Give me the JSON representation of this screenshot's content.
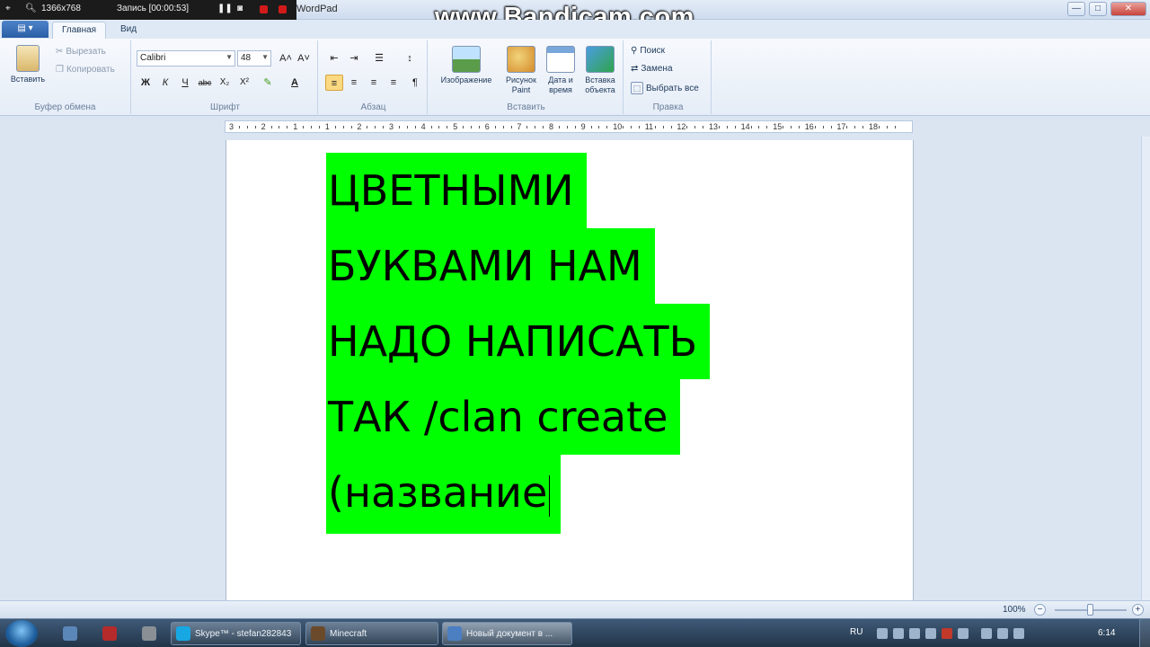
{
  "recorder": {
    "resolution": "1366x768",
    "record_label": "Запись [00:00:53]",
    "watermark": "www.Bandicam.com"
  },
  "window": {
    "title": "WordPad",
    "controls": {
      "minimize": "—",
      "maximize": "□",
      "close": "✕"
    }
  },
  "tabs": {
    "app_menu": "▤ ▾",
    "home": "Главная",
    "view": "Вид"
  },
  "ribbon": {
    "clipboard": {
      "label": "Буфер обмена",
      "paste": "Вставить",
      "cut": "Вырезать",
      "copy": "Копировать"
    },
    "font": {
      "label": "Шрифт",
      "family": "Calibri",
      "size": "48",
      "bold": "Ж",
      "italic": "К",
      "underline": "Ч",
      "strike": "abc",
      "subscript": "X₂",
      "superscript": "X²",
      "grow": "A˄",
      "shrink": "A˅",
      "highlight": "✎",
      "color": "A"
    },
    "paragraph": {
      "label": "Абзац",
      "decrease_indent": "⇤",
      "increase_indent": "⇥",
      "list": "☰",
      "spacing": "↕",
      "align_left": "≡",
      "align_center": "≡",
      "align_right": "≡",
      "justify": "≡",
      "paragraph_dialog": "¶"
    },
    "insert": {
      "label": "Вставить",
      "picture": "Изображение",
      "paint_line1": "Рисунок",
      "paint_line2": "Paint",
      "datetime_line1": "Дата и",
      "datetime_line2": "время",
      "object_line1": "Вставка",
      "object_line2": "объекта"
    },
    "editing": {
      "label": "Правка",
      "find": "Поиск",
      "replace": "Замена",
      "select_all": "Выбрать все"
    }
  },
  "ruler": {
    "labels": [
      "3",
      "2",
      "1",
      "1",
      "2",
      "3",
      "4",
      "5",
      "6",
      "7",
      "8",
      "9",
      "10",
      "11",
      "12",
      "13",
      "14",
      "15",
      "16",
      "17",
      "18"
    ]
  },
  "document": {
    "lines": [
      "ЦВЕТНЫМИ",
      "БУКВАМИ  НАМ",
      "НАДО НАПИСАТЬ",
      "ТАК /clan create",
      "(название"
    ],
    "highlight_color": "#00ff00"
  },
  "statusbar": {
    "zoom": "100%",
    "zoom_out": "−",
    "zoom_in": "+",
    "zoom_fraction": 0.45
  },
  "taskbar": {
    "buttons": [
      "Skype™ - stefan282843",
      "Minecraft",
      "Новый документ в ..."
    ],
    "language": "RU",
    "clock": "6:14"
  }
}
